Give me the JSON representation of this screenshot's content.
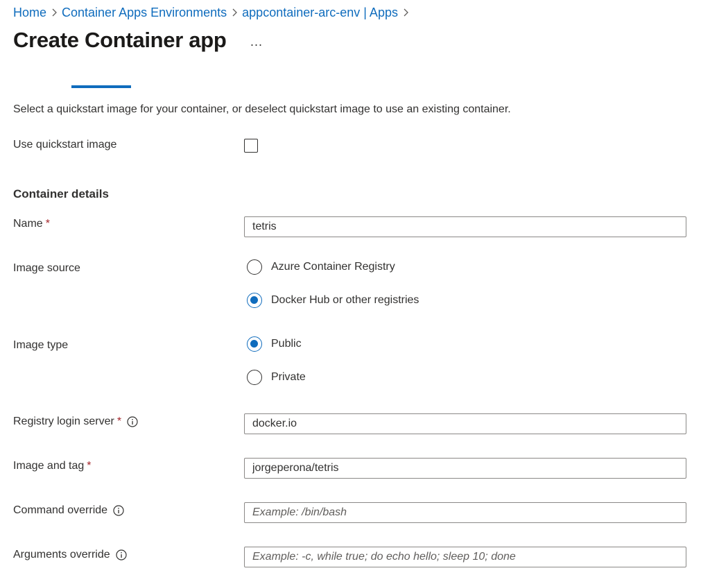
{
  "breadcrumb": {
    "items": [
      {
        "label": "Home"
      },
      {
        "label": "Container Apps Environments"
      },
      {
        "label": "appcontainer-arc-env | Apps"
      }
    ]
  },
  "header": {
    "title": "Create Container app",
    "more_label": "..."
  },
  "intro_text": "Select a quickstart image for your container, or deselect quickstart image to use an existing container.",
  "quickstart": {
    "label": "Use quickstart image",
    "checked": false
  },
  "section_title": "Container details",
  "fields": {
    "name": {
      "label": "Name",
      "required_mark": "*",
      "value": "tetris"
    },
    "image_source": {
      "label": "Image source",
      "options": [
        "Azure Container Registry",
        "Docker Hub or other registries"
      ],
      "selected": "Docker Hub or other registries"
    },
    "image_type": {
      "label": "Image type",
      "options": [
        "Public",
        "Private"
      ],
      "selected": "Public"
    },
    "registry_login_server": {
      "label": "Registry login server",
      "required_mark": "*",
      "value": "docker.io"
    },
    "image_and_tag": {
      "label": "Image and tag",
      "required_mark": "*",
      "value": "jorgeperona/tetris"
    },
    "command_override": {
      "label": "Command override",
      "value": "",
      "placeholder": "Example: /bin/bash"
    },
    "arguments_override": {
      "label": "Arguments override",
      "value": "",
      "placeholder": "Example: -c, while true; do echo hello; sleep 10; done"
    }
  },
  "colors": {
    "accent": "#0f6cbd",
    "required": "#a4262c",
    "text": "#323130",
    "border": "#8a8886"
  },
  "icons": {
    "chevron": "chevron-right-icon",
    "info": "info-icon"
  }
}
